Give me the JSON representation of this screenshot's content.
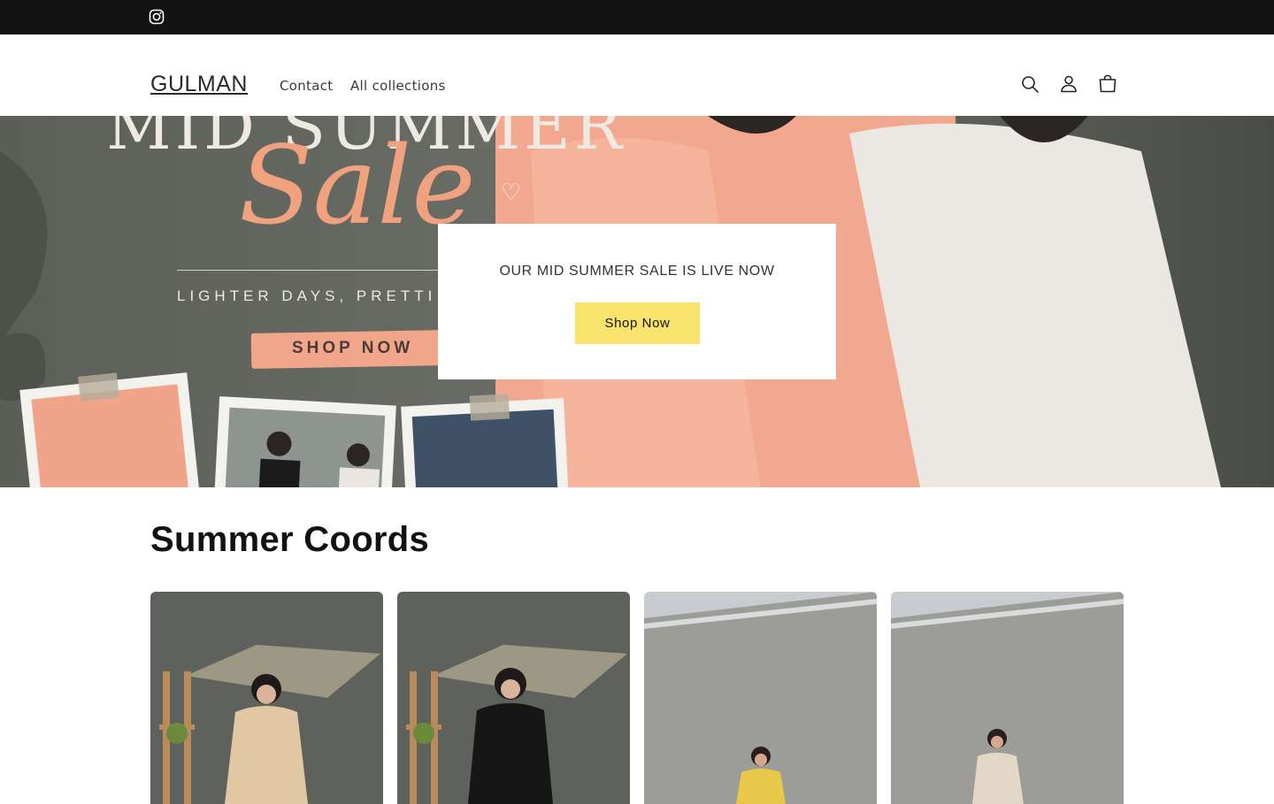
{
  "social": {
    "instagram_icon": "instagram-icon"
  },
  "header": {
    "logo": "GULMAN",
    "nav": [
      "Contact",
      "All collections"
    ],
    "icons": [
      "search-icon",
      "account-icon",
      "cart-icon"
    ]
  },
  "hero": {
    "banner": {
      "title": "MID SUMMER",
      "script": "Sale",
      "tagline": "LIGHTER DAYS, PRETTI",
      "cta": "SHOP NOW"
    },
    "heading": "OUR MID SUMMER SALE IS LIVE NOW",
    "button": "Shop Now",
    "colors": {
      "button": "#f8e36c",
      "banner_bg": "#6a6c66",
      "accent": "#f0a27f"
    }
  },
  "collection": {
    "title": "Summer Coords",
    "products": [
      {
        "image": "beige-coord-photo"
      },
      {
        "image": "black-coord-photo"
      },
      {
        "image": "yellow-coord-photo"
      },
      {
        "image": "cream-coord-photo"
      }
    ]
  }
}
